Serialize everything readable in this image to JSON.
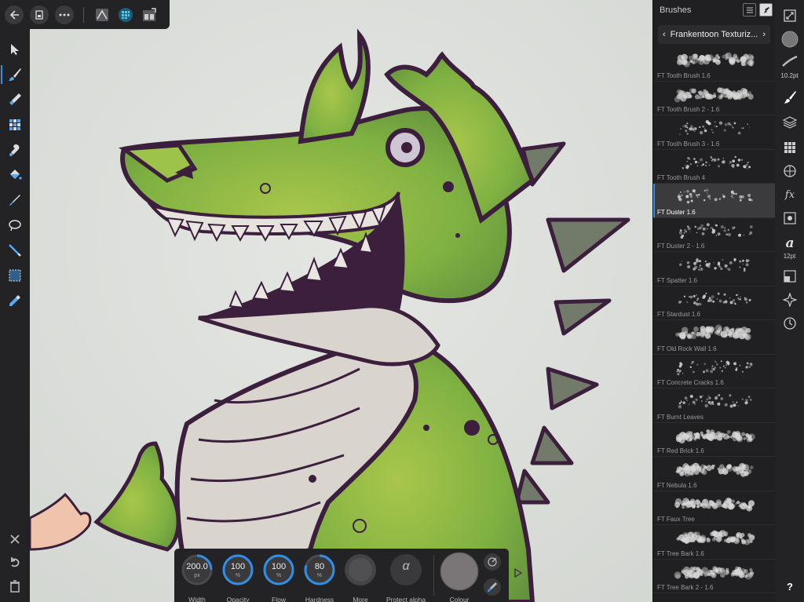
{
  "top_bar": {
    "back_icon": "back-arrow-icon",
    "document_icon": "document-icon",
    "more_icon": "more-icon",
    "personas": [
      "photo-persona-icon",
      "pixel-persona-icon",
      "export-persona-icon"
    ]
  },
  "left_tools": [
    "move-tool-icon",
    "paint-brush-icon",
    "erase-brush-icon",
    "fill-tool-icon",
    "smudge-brush-icon",
    "flood-fill-icon",
    "color-picker-brush-icon",
    "freehand-selection-icon",
    "selection-brush-icon",
    "marquee-icon",
    "eyedropper-icon"
  ],
  "left_bottom": [
    "close-icon",
    "undo-icon",
    "trash-icon"
  ],
  "brushes_panel": {
    "title": "Brushes",
    "category": "Frankentoon Texturiz...",
    "brushes": [
      {
        "name": "FT Tooth Brush 1.6"
      },
      {
        "name": "FT Tooth Brush 2 - 1.6"
      },
      {
        "name": "FT Tooth Brush 3 - 1.6"
      },
      {
        "name": "FT Tooth Brush 4"
      },
      {
        "name": "FT Duster 1.6"
      },
      {
        "name": "FT Duster 2 - 1.6"
      },
      {
        "name": "FT Spatter 1.6"
      },
      {
        "name": "FT Stardust 1.6"
      },
      {
        "name": "FT Old Rock Wall 1.6"
      },
      {
        "name": "FT Concrete Cracks 1.6"
      },
      {
        "name": "FT Burnt Leaves"
      },
      {
        "name": "FT Red Brick 1.6"
      },
      {
        "name": "FT Nebula 1.6"
      },
      {
        "name": "FT Faux Tree"
      },
      {
        "name": "FT Tree Bark 1.6"
      },
      {
        "name": "FT Tree Bark 2 - 1.6"
      }
    ],
    "selected_index": 4
  },
  "studio": {
    "brush_size_label": "10.2pt",
    "text_size_label": "12pt",
    "help_label": "?"
  },
  "context_bar": {
    "width": {
      "value": "200.0",
      "unit": "px",
      "label": "Width",
      "fraction": 0.25
    },
    "opacity": {
      "value": "100",
      "unit": "%",
      "label": "Opacity",
      "fraction": 1.0
    },
    "flow": {
      "value": "100",
      "unit": "%",
      "label": "Flow",
      "fraction": 1.0
    },
    "hardness": {
      "value": "80",
      "unit": "%",
      "label": "Hardness",
      "fraction": 0.8
    },
    "more_label": "More",
    "protect_alpha_symbol": "α",
    "protect_alpha_label": "Protect alpha",
    "colour_label": "Colour"
  },
  "colors": {
    "accent": "#2f8fe8",
    "canvas_bg": "#dfe2de",
    "croc_green": "#7cb342",
    "croc_outline": "#3b1f3d",
    "belly": "#d8d3cc",
    "swatch": "#7a7576"
  }
}
